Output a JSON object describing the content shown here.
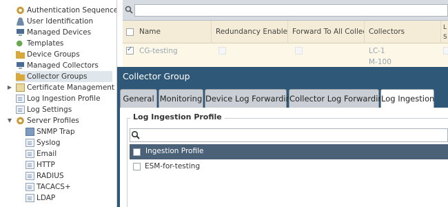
{
  "sidebar": {
    "items": [
      {
        "label": "Authentication Sequence",
        "icon": "gear-icon"
      },
      {
        "label": "User Identification",
        "icon": "user-icon"
      },
      {
        "label": "Managed Devices",
        "icon": "monitor-icon"
      },
      {
        "label": "Templates",
        "icon": "template-icon"
      },
      {
        "label": "Device Groups",
        "icon": "folder-icon"
      },
      {
        "label": "Managed Collectors",
        "icon": "monitor-icon"
      },
      {
        "label": "Collector Groups",
        "icon": "folder-icon"
      },
      {
        "label": "Certificate Management",
        "icon": "certificate-icon"
      },
      {
        "label": "Log Ingestion Profile",
        "icon": "document-icon"
      },
      {
        "label": "Log Settings",
        "icon": "document-icon"
      },
      {
        "label": "Server Profiles",
        "icon": "gear-icon"
      },
      {
        "label": "SNMP Trap",
        "icon": "grid-icon"
      },
      {
        "label": "Syslog",
        "icon": "document-icon"
      },
      {
        "label": "Email",
        "icon": "document-icon"
      },
      {
        "label": "HTTP",
        "icon": "document-icon"
      },
      {
        "label": "RADIUS",
        "icon": "document-icon"
      },
      {
        "label": "TACACS+",
        "icon": "document-icon"
      },
      {
        "label": "LDAP",
        "icon": "document-icon"
      }
    ]
  },
  "grid": {
    "columns": [
      "Name",
      "Redundancy Enabled",
      "Forward To All Collectors",
      "Collectors",
      "L S"
    ],
    "row": {
      "name": "CG-testing",
      "collectors": [
        "LC-1",
        "M-100"
      ]
    }
  },
  "dialog": {
    "title": "Collector Group",
    "tabs": [
      "General",
      "Monitoring",
      "Device Log Forwarding",
      "Collector Log Forwarding",
      "Log Ingestion"
    ],
    "active_tab": "Log Ingestion",
    "section_legend": "Log Ingestion Profile",
    "search_placeholder": "",
    "table": {
      "header": "Ingestion Profile",
      "rows": [
        "ESM-for-testing"
      ]
    }
  },
  "colors": {
    "dialog_bg": "#2f5878",
    "grid_header_bg": "#f4ecd6",
    "table_header_bg": "#4b6178"
  }
}
